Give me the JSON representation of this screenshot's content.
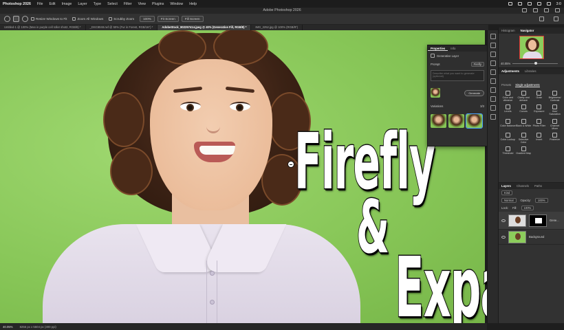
{
  "menubar": {
    "app_name": "Photoshop 2026",
    "items": [
      "File",
      "Edit",
      "Image",
      "Layer",
      "Type",
      "Select",
      "Filter",
      "View",
      "Plugins",
      "Window",
      "Help"
    ],
    "clock": "3:0"
  },
  "titlebar": {
    "title": "Adobe Photoshop 2026"
  },
  "options": {
    "resize_windows": "Resize Windows to Fit",
    "zoom_all": "Zoom All Windows",
    "scrubby_zoom": "Scrubby Zoom",
    "zoom_100": "100%",
    "fit_screen": "Fit Screen",
    "fill_screen": "Fill Screen"
  },
  "tabs": [
    {
      "label": "Untitled-1 @ 100% (Man in purple cell roller shot2, RGB/8) *",
      "active": false
    },
    {
      "label": "_DSC8048.nef @ 50% (Fur in Forest, RGB/16*) *",
      "active": false
    },
    {
      "label": "AdobeStock_802297414.jpeg @ 40% (Generative Fill, RGB/8) *",
      "active": true
    },
    {
      "label": "IMG_2252.jpg @ 100% (RGB/8*)",
      "active": false
    }
  ],
  "overlay": {
    "line1": "Firefly",
    "line2": "&",
    "line3": "Expand"
  },
  "properties": {
    "tab_properties": "Properties",
    "tab_info": "Info",
    "layer_type": "Generative Layer",
    "prompt_label": "Prompt",
    "model": "Firefly",
    "prompt_placeholder": "Describe what you want to generate (optional)",
    "generate": "Generate",
    "variations_label": "Variations",
    "variations_count": "3/3"
  },
  "navigator": {
    "tab_histogram": "Histogram",
    "tab_navigator": "Navigator",
    "zoom": "40.05%"
  },
  "adjustments": {
    "tab_adjustments": "Adjustments",
    "tab_libraries": "Libraries",
    "tab_presets": "Presets",
    "tab_single": "Single adjustments",
    "items": [
      "Color and vibrance",
      "Clarity and dehaze",
      "Grain",
      "Brightness/ Contrast",
      "Levels",
      "Curves",
      "Exposure",
      "Hue/ Saturation",
      "Color Balance",
      "Black & White",
      "Photo Filter",
      "Channel Mixer",
      "Color Lookup",
      "Selective Color",
      "Invert",
      "Posterize",
      "Threshold",
      "Gradient Map"
    ]
  },
  "layers": {
    "tab_layers": "Layers",
    "tab_channels": "Channels",
    "tab_paths": "Paths",
    "kind": "Kind",
    "blend": "Normal",
    "opacity_label": "Opacity:",
    "opacity": "100%",
    "lock_label": "Lock:",
    "fill_label": "Fill:",
    "fill": "100%",
    "rows": [
      {
        "name": "Gene..."
      },
      {
        "name": "Background"
      }
    ]
  },
  "status": {
    "zoom": "40.05%",
    "doc_info": "8256 px x 5504 px (300 ppi)"
  }
}
